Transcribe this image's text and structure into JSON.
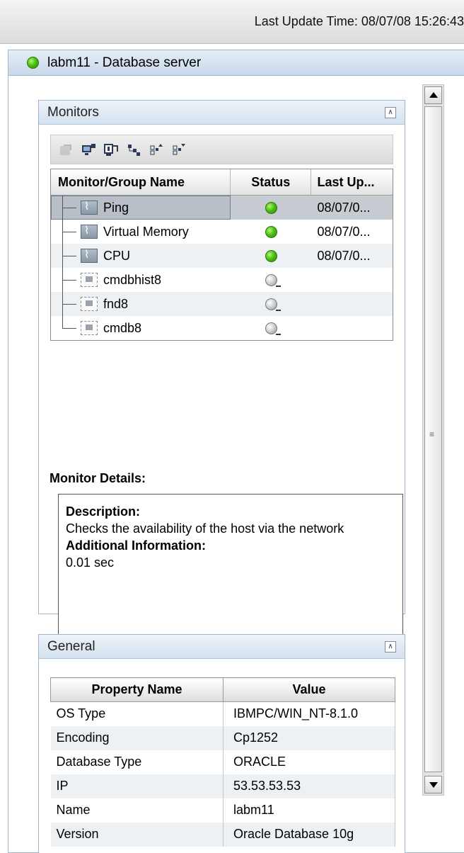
{
  "topbar": {
    "last_update": "Last Update Time: 08/07/08 15:26:43"
  },
  "header": {
    "title": "labm11 - Database server",
    "status_color": "#4cc014",
    "icon": "status-green-dot-icon"
  },
  "monitors_panel": {
    "title": "Monitors",
    "toolbar_icons": [
      "remove-monitor-icon",
      "monitor-computer-icon",
      "monitor-properties-icon",
      "tree-view-icon",
      "sort-up-icon",
      "sort-down-icon"
    ],
    "columns": [
      "Monitor/Group Name",
      "Status",
      "Last Up..."
    ],
    "rows": [
      {
        "name": "Ping",
        "type": "monitor",
        "status": "ok",
        "last_update": "08/07/0..."
      },
      {
        "name": "Virtual Memory",
        "type": "monitor",
        "status": "ok",
        "last_update": "08/07/0..."
      },
      {
        "name": "CPU",
        "type": "monitor",
        "status": "ok",
        "last_update": "08/07/0..."
      },
      {
        "name": "cmdbhist8",
        "type": "group",
        "status": "unknown",
        "last_update": ""
      },
      {
        "name": "fnd8",
        "type": "group",
        "status": "unknown",
        "last_update": ""
      },
      {
        "name": "cmdb8",
        "type": "group",
        "status": "unknown",
        "last_update": ""
      }
    ],
    "details": {
      "label": "Monitor Details:",
      "description_label": "Description:",
      "description": "Checks the availability of the host via the network",
      "additional_label": "Additional Information:",
      "additional": "0.01 sec"
    }
  },
  "general_panel": {
    "title": "General",
    "columns": [
      "Property Name",
      "Value"
    ],
    "rows": [
      {
        "name": "OS Type",
        "value": "IBMPC/WIN_NT-8.1.0"
      },
      {
        "name": "Encoding",
        "value": "Cp1252"
      },
      {
        "name": "Database Type",
        "value": "ORACLE"
      },
      {
        "name": "IP",
        "value": "53.53.53.53"
      },
      {
        "name": "Name",
        "value": "labm11"
      },
      {
        "name": "Version",
        "value": "Oracle Database 10g"
      }
    ]
  }
}
